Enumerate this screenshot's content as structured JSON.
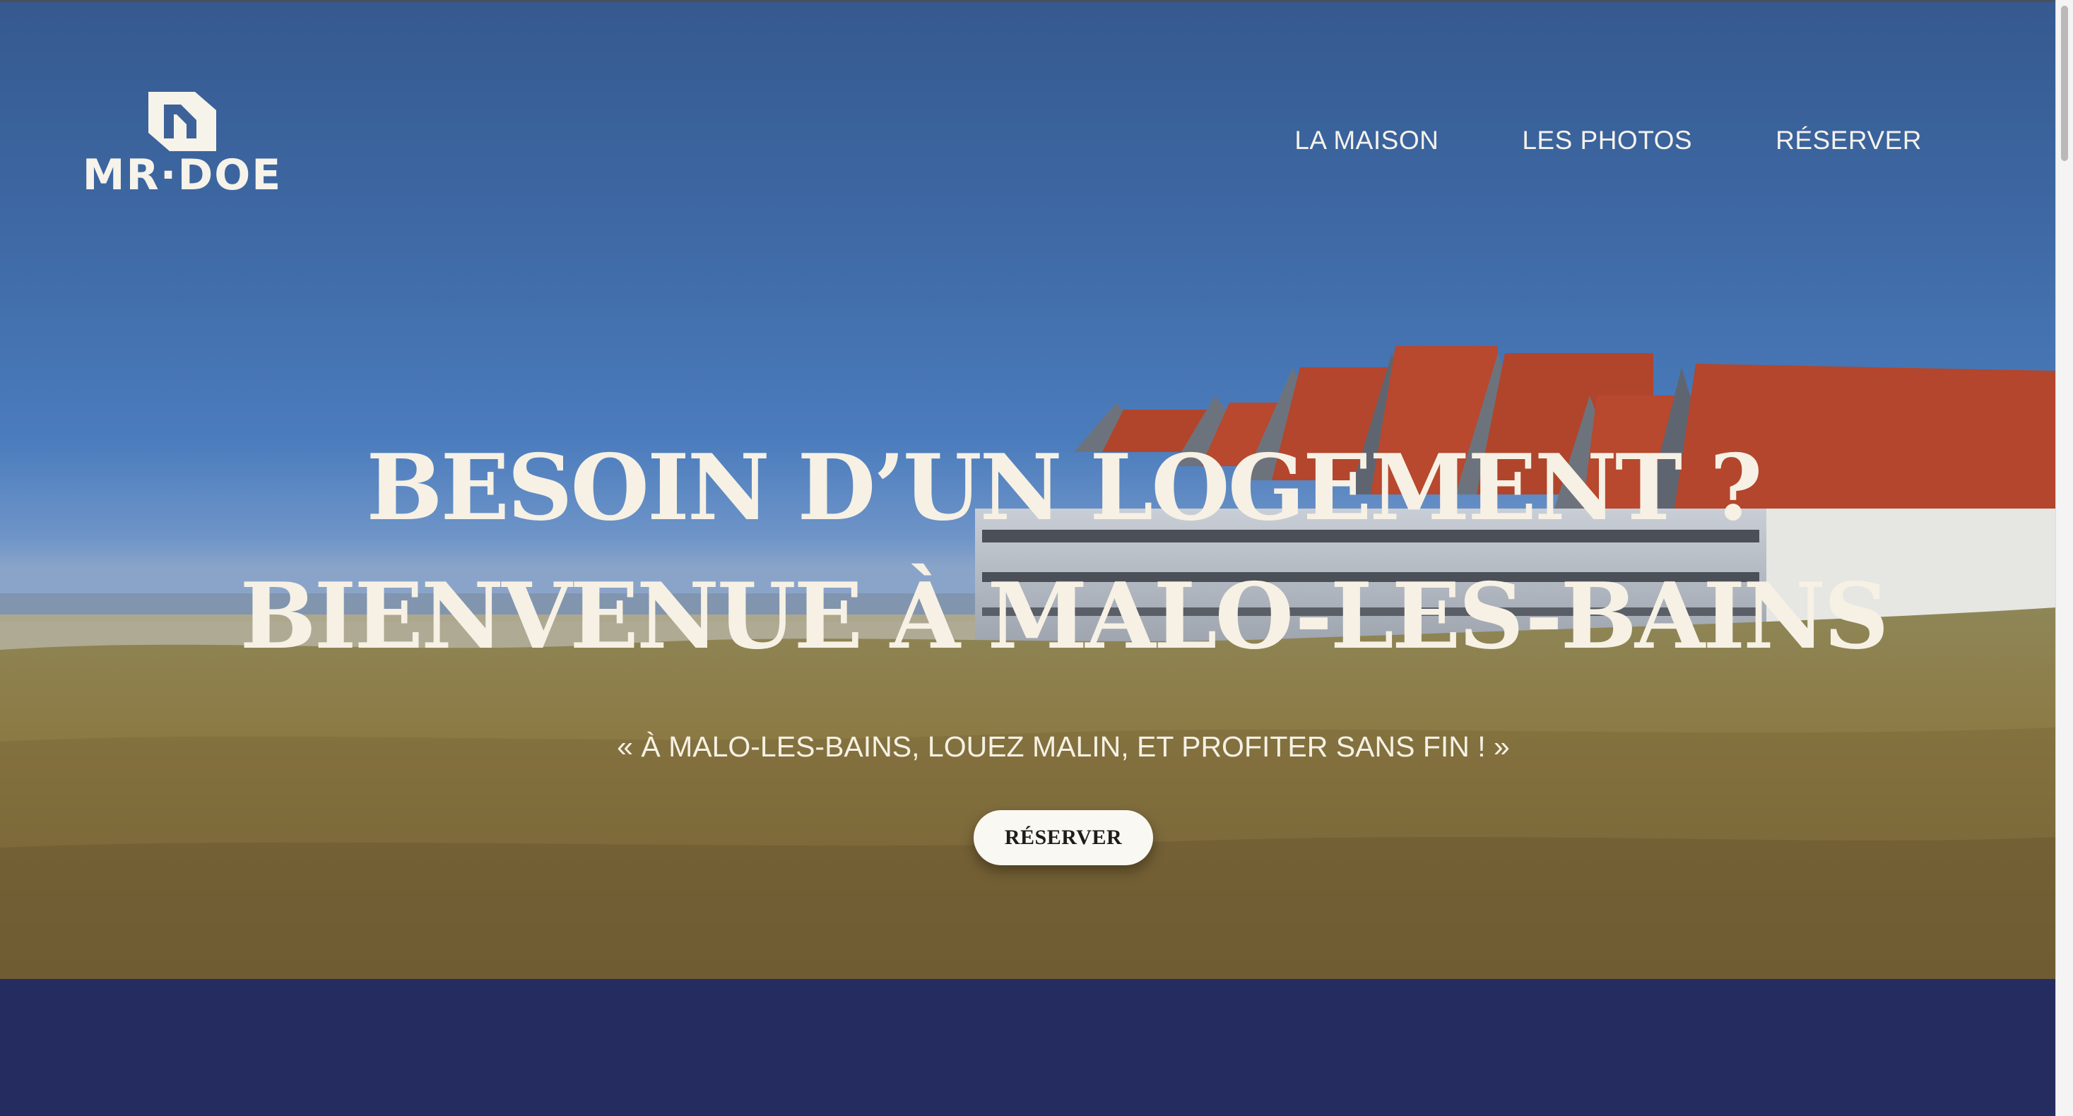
{
  "brand": {
    "logo_text": "MR·DOE"
  },
  "nav": {
    "items": [
      {
        "label": "LA MAISON"
      },
      {
        "label": "LES PHOTOS"
      },
      {
        "label": "RÉSERVER"
      }
    ]
  },
  "hero": {
    "headline_line1": "BESOIN D’UN LOGEMENT ?",
    "headline_line2": "BIENVENUE À MALO-LES-BAINS",
    "tagline": "« À MALO-LES-BAINS, LOUEZ MALIN, ET PROFITER SANS FIN ! »",
    "cta_label": "RÉSERVER"
  },
  "colors": {
    "sky": "#3f6aa6",
    "grass": "#8c7a44",
    "roof": "#b8482e",
    "footer_band": "#252c5f",
    "text_light": "#f6f1e4"
  },
  "icons": {
    "logo_mark": "mr-doe-logo-icon"
  }
}
